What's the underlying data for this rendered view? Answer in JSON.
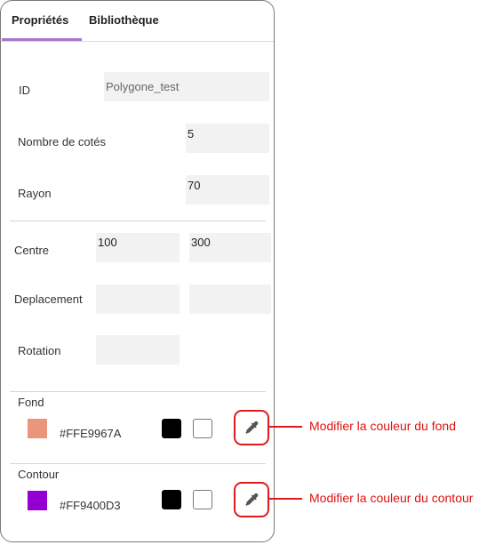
{
  "tabs": [
    {
      "label": "Propriétés",
      "active": true
    },
    {
      "label": "Bibliothèque",
      "active": false
    }
  ],
  "fields": {
    "id": {
      "label": "ID",
      "value": "Polygone_test"
    },
    "sides": {
      "label": "Nombre de cotés",
      "value": "5"
    },
    "radius": {
      "label": "Rayon",
      "value": "70"
    },
    "center": {
      "label": "Centre",
      "x": "100",
      "y": "300"
    },
    "displacement": {
      "label": "Deplacement",
      "x": "",
      "y": ""
    },
    "rotation": {
      "label": "Rotation",
      "value": ""
    }
  },
  "fill": {
    "label": "Fond",
    "hex": "#FFE9967A",
    "color": "#e9967a"
  },
  "stroke": {
    "label": "Contour",
    "hex": "#FF9400D3",
    "color": "#9400d3"
  },
  "annotations": {
    "fill": "Modifier la couleur du fond",
    "stroke": "Modifier la couleur du contour"
  },
  "colors": {
    "accent": "#a875c8",
    "annotation": "#e01b1b"
  }
}
